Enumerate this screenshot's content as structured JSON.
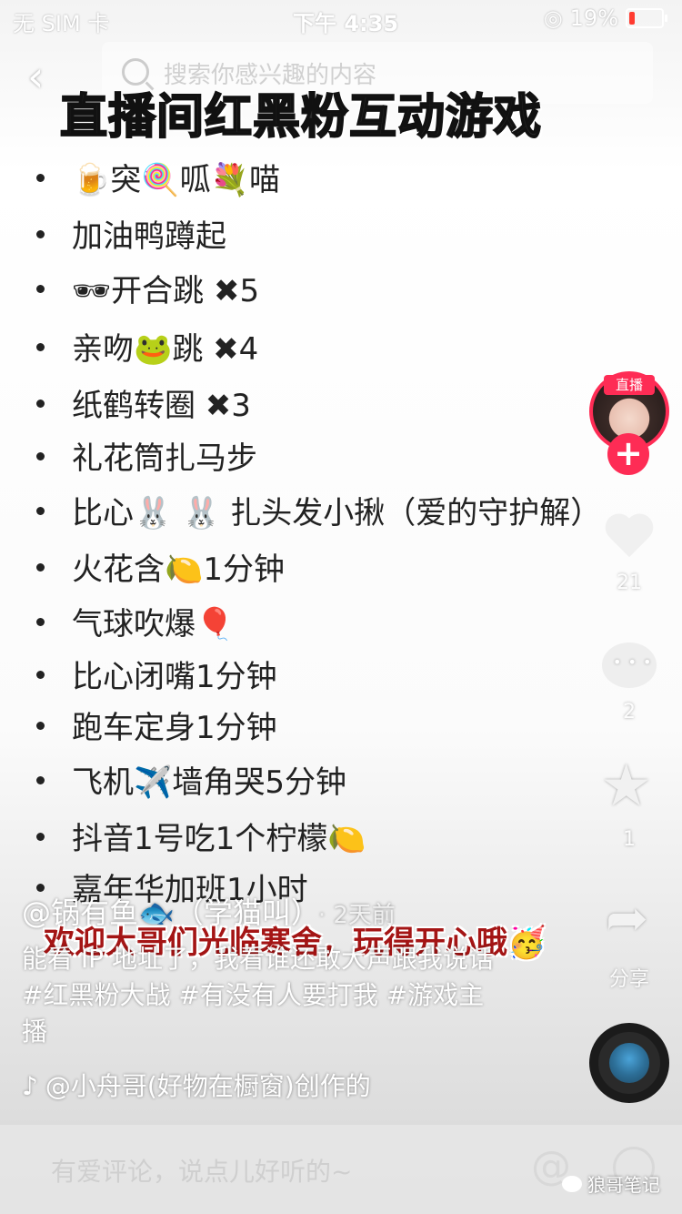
{
  "status_bar": {
    "carrier": "无 SIM 卡",
    "time": "下午 4:35",
    "battery": "19%",
    "battery_level": 0.19
  },
  "search": {
    "placeholder": "搜索你感兴趣的内容"
  },
  "video": {
    "title": "直播间红黑粉互动游戏",
    "items": [
      "🍺突🍭呱💐喵",
      "加油鸭蹲起",
      "🕶开合跳 ✖5",
      "亲吻🐸跳 ✖4",
      "纸鹤转圈 ✖3",
      "礼花筒扎马步",
      "比心🐰 🐰 扎头发小揪（爱的守护解）",
      "火花含🍋1分钟",
      "气球吹爆🎈",
      "比心闭嘴1分钟",
      "跑车定身1分钟",
      "飞机✈️墙角哭5分钟",
      "抖音1号吃1个柠檬🍋",
      "嘉年华加班1小时"
    ],
    "overlay_text": "欢迎大哥们光临寒舍，玩得开心哦🥳"
  },
  "rail": {
    "live_badge": "直播",
    "follow": "+",
    "likes": "21",
    "comments": "2",
    "favorites": "1",
    "share_label": "分享"
  },
  "caption": {
    "author": "@锅有鱼🐟（学猫叫）",
    "time": "· 2天前",
    "description": "能看 IP 地址了，我看谁还敢大声跟我说话#红黑粉大战 #有没有人要打我 #游戏主播",
    "music_icon": "♪",
    "music": "@小舟哥(好物在橱窗)创作的"
  },
  "comment": {
    "placeholder": "有爱评论，说点儿好听的~",
    "at": "@"
  },
  "watermark": {
    "text": "狼哥笔记"
  }
}
